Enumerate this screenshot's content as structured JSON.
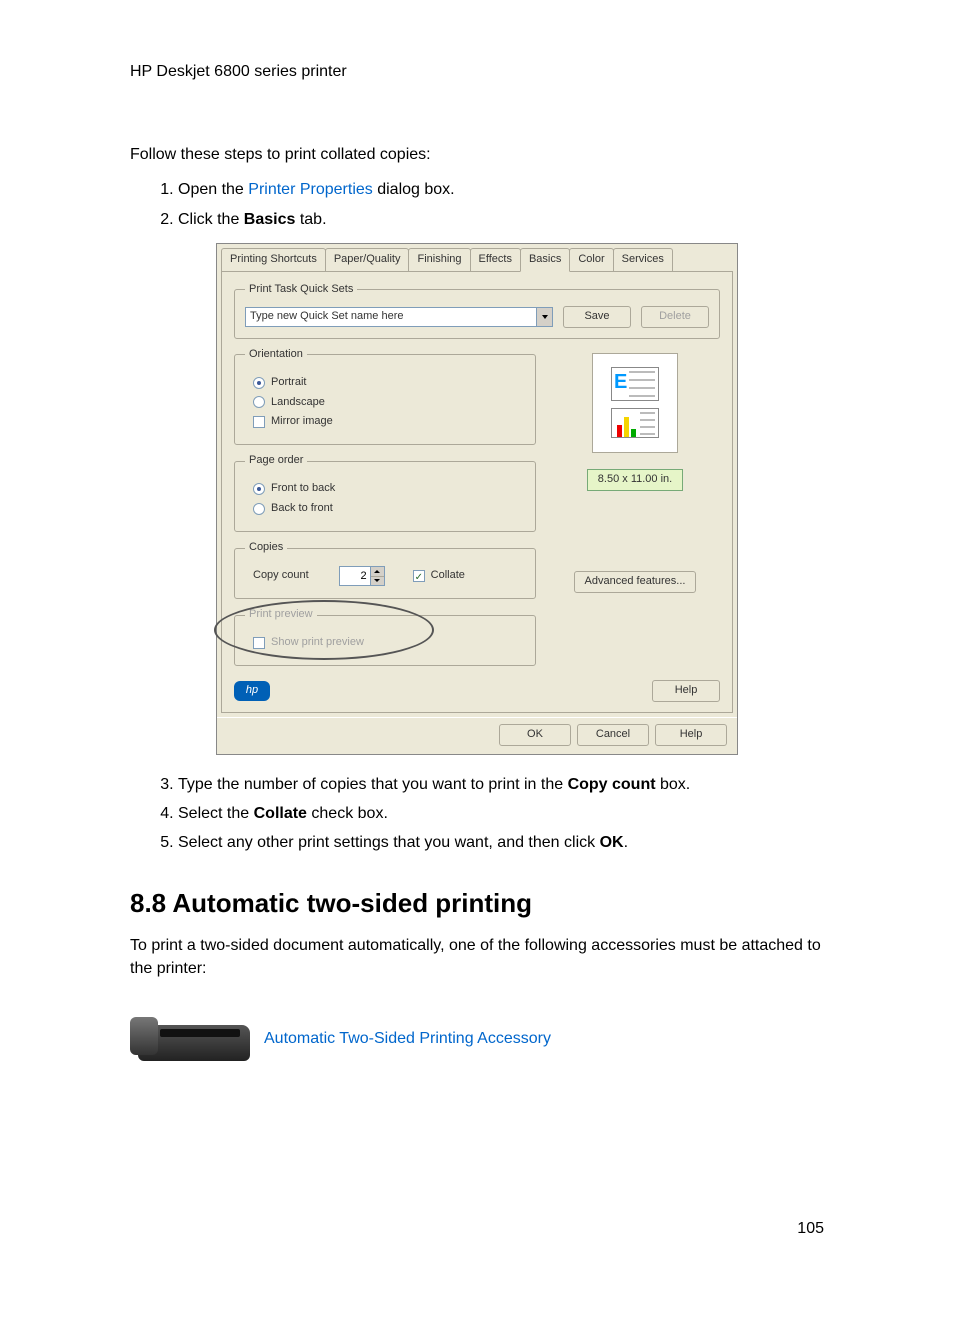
{
  "header": {
    "title": "HP Deskjet 6800 series printer"
  },
  "lead": "Follow these steps to print collated copies:",
  "steps_a": {
    "s1_pre": "Open the ",
    "s1_link": "Printer Properties",
    "s1_post": " dialog box.",
    "s2_pre": "Click the ",
    "s2_bold": "Basics",
    "s2_post": " tab."
  },
  "dialog": {
    "tabs": [
      "Printing Shortcuts",
      "Paper/Quality",
      "Finishing",
      "Effects",
      "Basics",
      "Color",
      "Services"
    ],
    "quicksets": {
      "legend": "Print Task Quick Sets",
      "placeholder": "Type new Quick Set name here",
      "save": "Save",
      "delete": "Delete"
    },
    "orientation": {
      "legend": "Orientation",
      "portrait": "Portrait",
      "landscape": "Landscape",
      "mirror": "Mirror image"
    },
    "pageorder": {
      "legend": "Page order",
      "ftb": "Front to back",
      "btf": "Back to front"
    },
    "copies": {
      "legend": "Copies",
      "count_label": "Copy count",
      "count_value": "2",
      "collate": "Collate"
    },
    "preview_size": "8.50 x 11.00 in.",
    "advanced": "Advanced features...",
    "printpreview": {
      "legend": "Print preview",
      "show": "Show print preview"
    },
    "help": "Help",
    "ok": "OK",
    "cancel": "Cancel",
    "help2": "Help",
    "sheet_letter": "E"
  },
  "steps_b": {
    "s3_pre": "Type the number of copies that you want to print in the ",
    "s3_bold": "Copy count",
    "s3_post": " box.",
    "s4_pre": "Select the ",
    "s4_bold": "Collate",
    "s4_post": " check box.",
    "s5_pre": "Select any other print settings that you want, and then click ",
    "s5_bold": "OK",
    "s5_post": "."
  },
  "section": {
    "heading": "8.8  Automatic two-sided printing",
    "body": "To print a two-sided document automatically, one of the following accessories must be attached to the printer:",
    "link": "Automatic Two-Sided Printing Accessory"
  },
  "pagenum": "105"
}
